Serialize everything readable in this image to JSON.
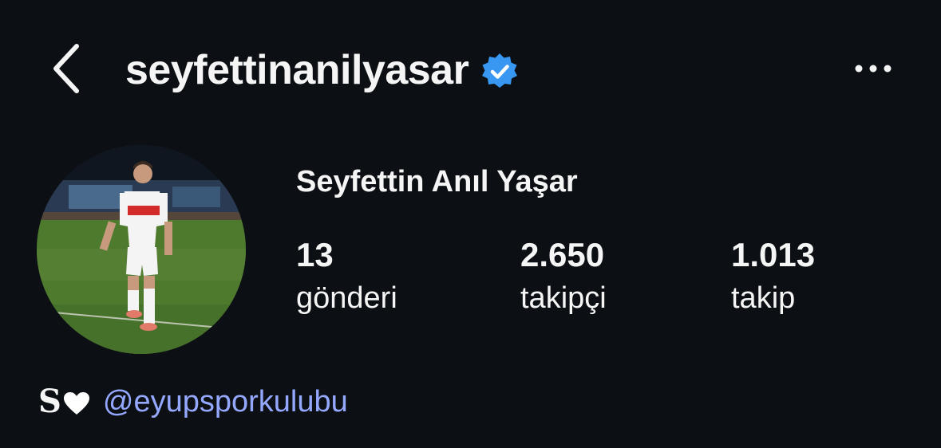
{
  "header": {
    "back_icon": "chevron-left-icon",
    "username": "seyfettinanilyasar",
    "verified_icon": "verified-badge-icon",
    "more_icon": "more-horizontal-icon"
  },
  "profile": {
    "display_name": "Seyfettin Anıl Yaşar",
    "stats": [
      {
        "value": "13",
        "label": "gönderi"
      },
      {
        "value": "2.650",
        "label": "takipçi"
      },
      {
        "value": "1.013",
        "label": "takip"
      }
    ]
  },
  "bio": {
    "letter": "S",
    "heart_icon": "white-heart-icon",
    "mention": "@eyupsporkulubu"
  },
  "colors": {
    "background": "#0c1014",
    "text": "#f5f5f5",
    "verified": "#3897f0",
    "link": "#95a8ff"
  }
}
